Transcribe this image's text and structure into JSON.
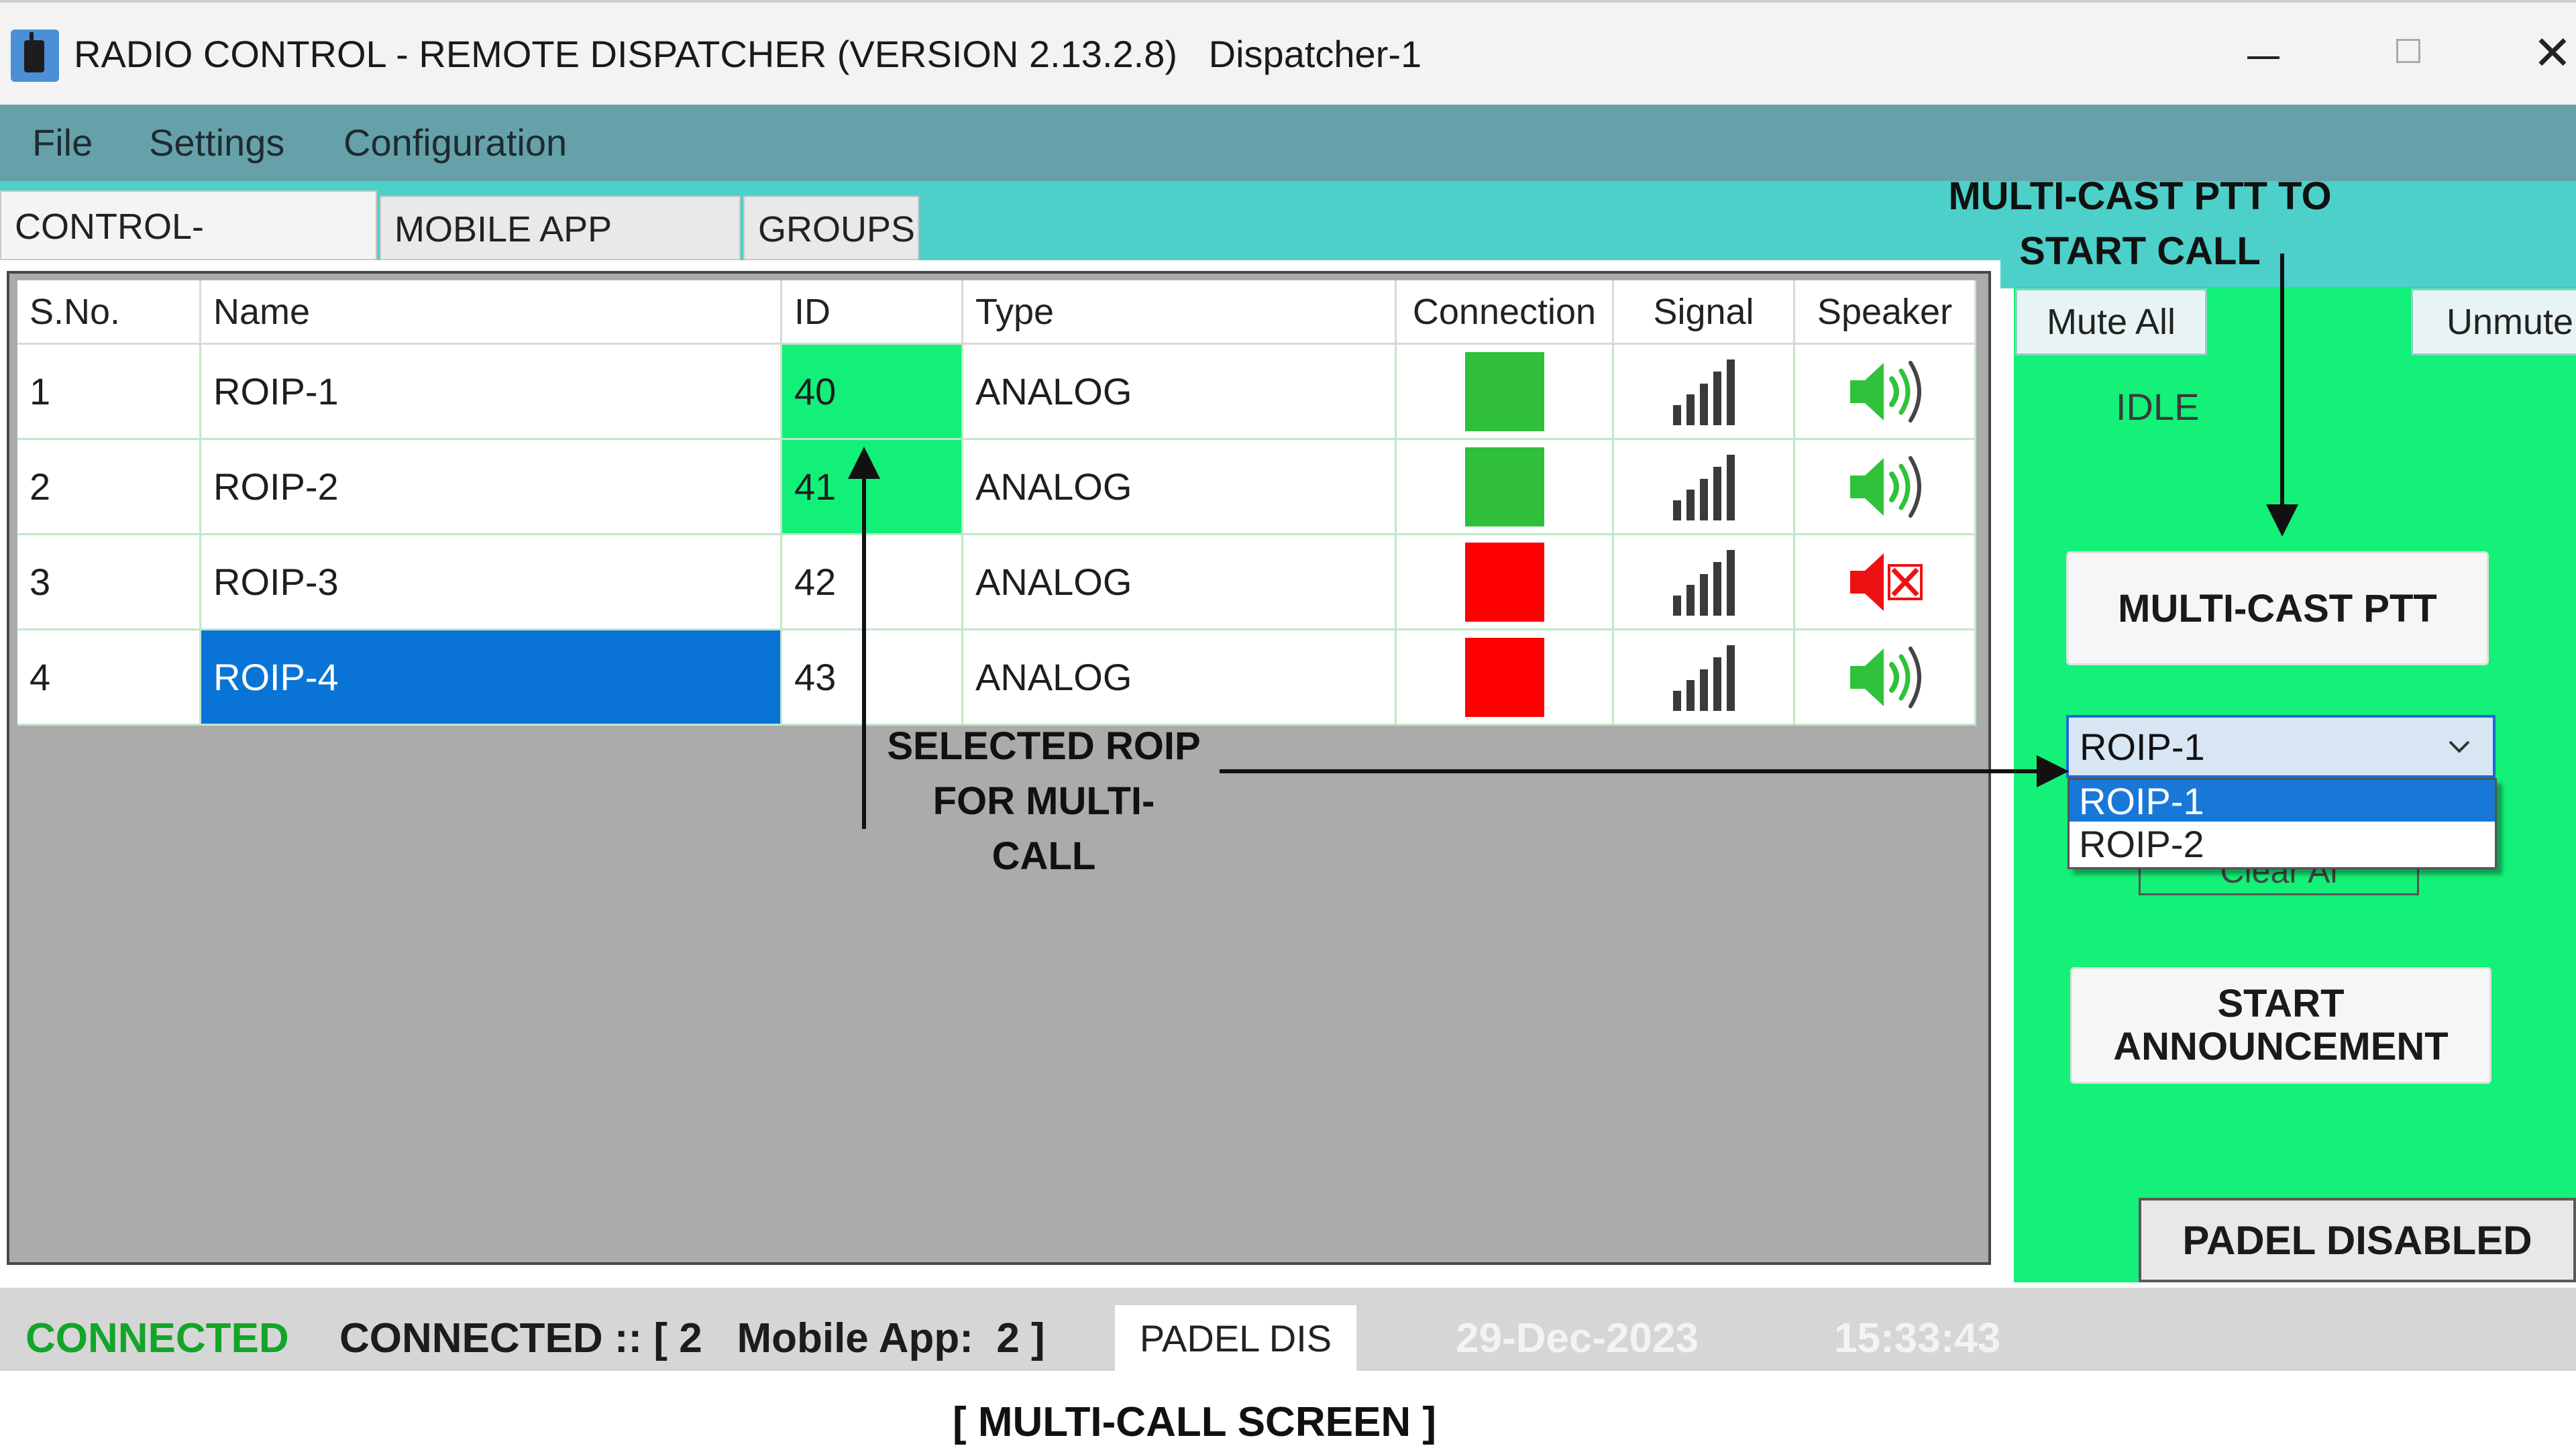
{
  "window": {
    "title": "RADIO CONTROL - REMOTE DISPATCHER (VERSION 2.13.2.8)   Dispatcher-1",
    "minimize_glyph": "—",
    "close_glyph": "✕"
  },
  "menu": {
    "items": [
      "File",
      "Settings",
      "Configuration"
    ]
  },
  "tabs": [
    "CONTROL-STATIONS",
    "MOBILE APP USERS",
    "GROUPS"
  ],
  "grid": {
    "headers": [
      "S.No.",
      "Name",
      "ID",
      "Type",
      "Connection",
      "Signal",
      "Speaker"
    ],
    "rows": [
      {
        "sno": "1",
        "name": "ROIP-1",
        "id": "40",
        "type": "ANALOG",
        "connection": "green",
        "speaker": "speaker-on-icon"
      },
      {
        "sno": "2",
        "name": "ROIP-2",
        "id": "41",
        "type": "ANALOG",
        "connection": "green",
        "speaker": "speaker-on-icon"
      },
      {
        "sno": "3",
        "name": "ROIP-3",
        "id": "42",
        "type": "ANALOG",
        "connection": "red",
        "speaker": "speaker-muted-icon"
      },
      {
        "sno": "4",
        "name": "ROIP-4",
        "id": "43",
        "type": "ANALOG",
        "connection": "red",
        "speaker": "speaker-on-icon"
      }
    ]
  },
  "panel": {
    "mute_all": "Mute All",
    "unmute_all": "Unmute A",
    "status": "IDLE",
    "multicast_button": "MULTI-CAST PTT",
    "dropdown_value": "ROIP-1",
    "dropdown_options": [
      "ROIP-1",
      "ROIP-2"
    ],
    "clear_all_partial": "Clear Al",
    "announcement_button": "START\nANNOUNCEMENT",
    "padel_button": "PADEL DISABLED"
  },
  "annotations": {
    "multicast": "MULTI-CAST PTT TO\nSTART CALL",
    "selected": "SELECTED ROIP\nFOR MULTI-\nCALL",
    "caption": "[ MULTI-CALL  SCREEN ]"
  },
  "statusbar": {
    "connected": "CONNECTED",
    "detail": "CONNECTED :: [ 2   Mobile App:  2 ]",
    "padel": "PADEL DIS",
    "date": "29-Dec-2023",
    "time": "15:33:43"
  },
  "colors": {
    "menu_bg": "#66a1a9",
    "tab_strip": "#4dd0c9",
    "panel_green": "#13f178",
    "status_green": "#2fbf3a",
    "status_red": "#ff0000",
    "selection_blue": "#0a74d6",
    "id_highlight": "#12f07a"
  }
}
